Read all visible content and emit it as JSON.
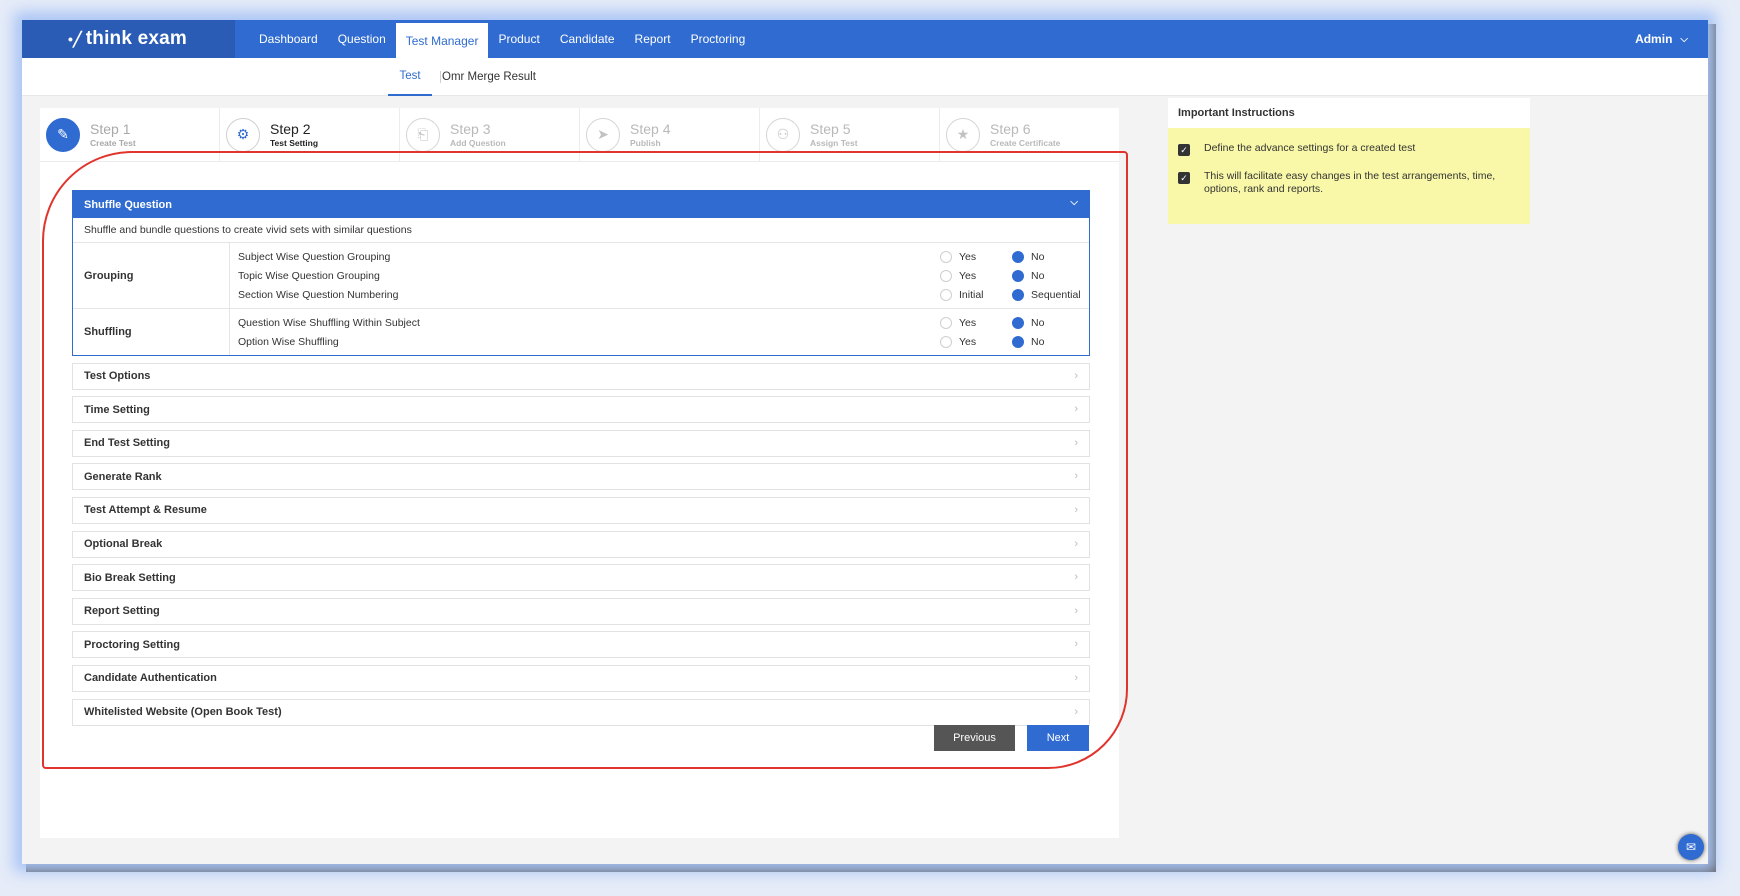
{
  "brand": {
    "logo_text": "think exam"
  },
  "topnav": {
    "items": [
      {
        "label": "Dashboard",
        "active": false
      },
      {
        "label": "Question",
        "active": false
      },
      {
        "label": "Test Manager",
        "active": true
      },
      {
        "label": "Product",
        "active": false
      },
      {
        "label": "Candidate",
        "active": false
      },
      {
        "label": "Report",
        "active": false
      },
      {
        "label": "Proctoring",
        "active": false
      }
    ],
    "user": "Admin"
  },
  "subnav": {
    "tabs": [
      {
        "label": "Test"
      },
      {
        "label": "Omr Merge Result"
      }
    ]
  },
  "steps": [
    {
      "number": "Step 1",
      "label": "Create Test",
      "state": "done",
      "icon": "pencil-icon"
    },
    {
      "number": "Step 2",
      "label": "Test Setting",
      "state": "current",
      "icon": "gear-icon"
    },
    {
      "number": "Step 3",
      "label": "Add Question",
      "state": "pending",
      "icon": "file-icon"
    },
    {
      "number": "Step 4",
      "label": "Publish",
      "state": "pending",
      "icon": "rocket-icon"
    },
    {
      "number": "Step 5",
      "label": "Assign Test",
      "state": "pending",
      "icon": "users-icon"
    },
    {
      "number": "Step 6",
      "label": "Create Certificate",
      "state": "pending",
      "icon": "star-icon"
    }
  ],
  "shuffle": {
    "title": "Shuffle Question",
    "description": "Shuffle and bundle questions to create vivid sets with similar questions",
    "groups": [
      {
        "label": "Grouping",
        "rows": [
          {
            "question": "Subject Wise Question Grouping",
            "opt1": "Yes",
            "opt2": "No",
            "selected": 2
          },
          {
            "question": "Topic Wise Question Grouping",
            "opt1": "Yes",
            "opt2": "No",
            "selected": 2
          },
          {
            "question": "Section Wise Question Numbering",
            "opt1": "Initial",
            "opt2": "Sequential",
            "selected": 2
          }
        ]
      },
      {
        "label": "Shuffling",
        "rows": [
          {
            "question": "Question Wise Shuffling Within Subject",
            "opt1": "Yes",
            "opt2": "No",
            "selected": 2
          },
          {
            "question": "Option Wise Shuffling",
            "opt1": "Yes",
            "opt2": "No",
            "selected": 2
          }
        ]
      }
    ]
  },
  "sections": [
    "Test Options",
    "Time Setting",
    "End Test Setting",
    "Generate Rank",
    "Test Attempt & Resume",
    "Optional Break",
    "Bio Break Setting",
    "Report Setting",
    "Proctoring Setting",
    "Candidate Authentication",
    "Whitelisted Website (Open Book Test)"
  ],
  "buttons": {
    "previous": "Previous",
    "next": "Next"
  },
  "instructions": {
    "title": "Important Instructions",
    "items": [
      "Define the advance settings for a created test",
      "This will facilitate easy changes in the test arrangements, time, options, rank and reports."
    ]
  },
  "colors": {
    "primary": "#2f6bd0",
    "highlight": "#e0342c",
    "note_bg": "#f8f8a8"
  }
}
